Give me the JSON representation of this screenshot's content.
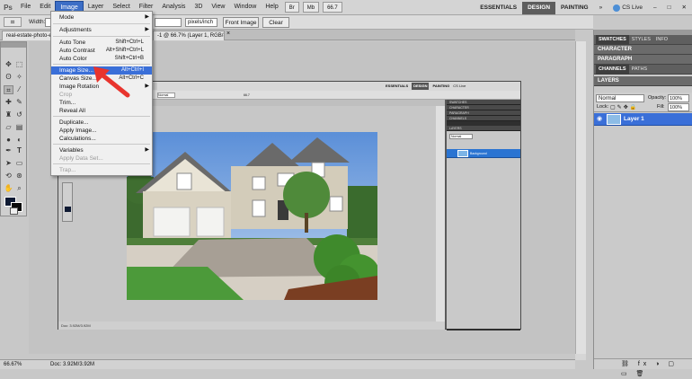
{
  "menubar": {
    "logo": "Ps",
    "items": [
      "File",
      "Edit",
      "Image",
      "Layer",
      "Select",
      "Filter",
      "Analysis",
      "3D",
      "View",
      "Window",
      "Help"
    ],
    "zoom": "66.7",
    "workspaces": [
      "ESSENTIALS",
      "DESIGN",
      "PAINTING"
    ],
    "cs_live": "CS Live"
  },
  "optbar": {
    "width_label": "Width:",
    "resolution_unit": "pixels/inch",
    "front_image": "Front Image",
    "clear": "Clear"
  },
  "doc": {
    "tab_title": "real-estate-photo-editing @ 66.7% (Layer 1, RGB/8)",
    "menu_tail": "-1 @ 66.7% (Layer 1, RGB/8)",
    "status_zoom": "66.67%",
    "status_doc": "Doc: 3.92M/3.92M"
  },
  "image_menu": {
    "items": [
      {
        "label": "Mode",
        "arrow": true
      },
      {
        "label": "Adjustments",
        "arrow": true
      },
      {
        "label": "Auto Tone",
        "shortcut": "Shift+Ctrl+L"
      },
      {
        "label": "Auto Contrast",
        "shortcut": "Alt+Shift+Ctrl+L"
      },
      {
        "label": "Auto Color",
        "shortcut": "Shift+Ctrl+B"
      },
      {
        "label": "Image Size...",
        "shortcut": "Alt+Ctrl+I"
      },
      {
        "label": "Canvas Size...",
        "shortcut": "Alt+Ctrl+C"
      },
      {
        "label": "Image Rotation",
        "arrow": true
      },
      {
        "label": "Crop"
      },
      {
        "label": "Trim..."
      },
      {
        "label": "Reveal All"
      },
      {
        "label": "Duplicate..."
      },
      {
        "label": "Apply Image..."
      },
      {
        "label": "Calculations..."
      },
      {
        "label": "Variables",
        "arrow": true
      },
      {
        "label": "Apply Data Set..."
      },
      {
        "label": "Trap..."
      }
    ]
  },
  "panels": {
    "row1": [
      "SWATCHES",
      "STYLES",
      "INFO"
    ],
    "character": "CHARACTER",
    "paragraph": "PARAGRAPH",
    "row4": [
      "CHANNELS",
      "PATHS"
    ],
    "layers": "LAYERS",
    "blend_mode": "Normal",
    "opacity_label": "Opacity:",
    "opacity_value": "100%",
    "lock_label": "Lock:",
    "fill_label": "Fill:",
    "fill_value": "100%",
    "layer_name": "Layer 1"
  },
  "inner": {
    "workspaces": [
      "ESSENTIALS",
      "DESIGN",
      "PAINTING"
    ],
    "cs_live": "CS Live",
    "panels": [
      "SWATCHES",
      "CHARACTER",
      "PARAGRAPH",
      "CHANNELS",
      "LAYERS"
    ],
    "blend_mode": "Normal",
    "layer_name": "Background",
    "status": "Doc: 3.92M/3.92M",
    "opt_zoom": "66.7"
  },
  "colors": {
    "accent": "#3a6fd8",
    "arrow": "#e8342d",
    "panel_dark": "#5f5f5f"
  }
}
